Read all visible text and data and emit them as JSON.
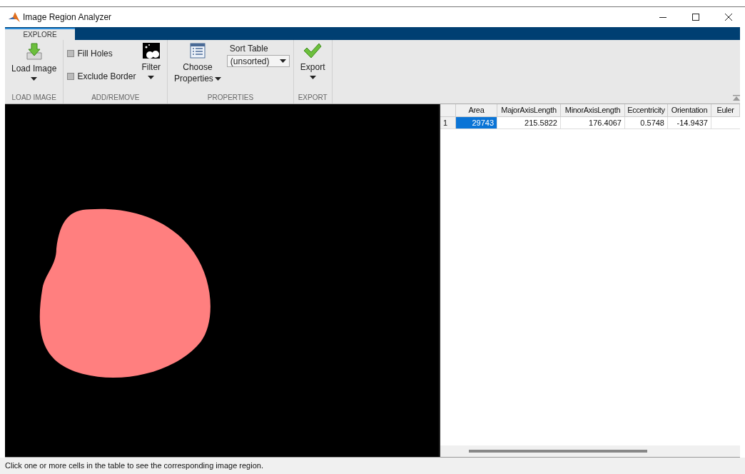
{
  "window": {
    "title": "Image Region Analyzer"
  },
  "tabs": [
    {
      "label": "EXPLORE",
      "selected": true
    }
  ],
  "ribbon": {
    "groups": [
      {
        "label": "LOAD IMAGE",
        "items": [
          {
            "kind": "button",
            "lines": [
              "Load Image"
            ]
          }
        ]
      },
      {
        "label": "ADD/REMOVE",
        "items": [
          {
            "kind": "checks",
            "checks": [
              {
                "label": "Fill Holes",
                "checked": false
              },
              {
                "label": "Exclude Border",
                "checked": false
              }
            ]
          },
          {
            "kind": "button",
            "lines": [
              "Filter"
            ]
          }
        ]
      },
      {
        "label": "PROPERTIES",
        "items": [
          {
            "kind": "button",
            "lines": [
              "Choose",
              "Properties"
            ]
          },
          {
            "kind": "select",
            "label": "Sort Table",
            "value": "(unsorted)"
          }
        ]
      },
      {
        "label": "EXPORT",
        "items": [
          {
            "kind": "button",
            "lines": [
              "Export"
            ]
          }
        ]
      }
    ]
  },
  "table": {
    "columns": [
      "Area",
      "MajorAxisLength",
      "MinorAxisLength",
      "Eccentricity",
      "Orientation",
      "Euler"
    ],
    "rows": [
      {
        "header": "1",
        "cells": [
          {
            "value": "29743",
            "selected": true
          },
          {
            "value": "215.5822",
            "selected": false
          },
          {
            "value": "176.4067",
            "selected": false
          },
          {
            "value": "0.5748",
            "selected": false
          },
          {
            "value": "-14.9437",
            "selected": false
          }
        ]
      }
    ]
  },
  "status_bar": "Click one or more cells in the table to see the corresponding image region."
}
